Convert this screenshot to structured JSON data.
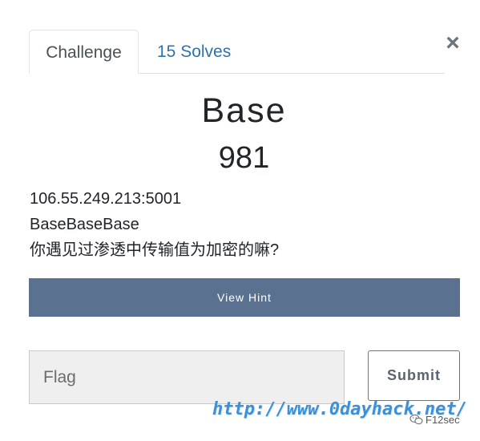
{
  "tabs": {
    "challenge_label": "Challenge",
    "solves_label": "15 Solves"
  },
  "close_icon": "close-icon",
  "challenge": {
    "name": "Base",
    "value": "981",
    "description": [
      "106.55.249.213:5001",
      "BaseBaseBase",
      "你遇见过渗透中传输值为加密的嘛?"
    ]
  },
  "hint": {
    "label": "View Hint"
  },
  "flag": {
    "placeholder": "Flag",
    "value": ""
  },
  "submit": {
    "label": "Submit"
  },
  "watermark": {
    "url": "http://www.0dayhack.net/",
    "brand": "F12sec",
    "icon": "wechat-icon"
  },
  "colors": {
    "hint_button": "#5b7190",
    "link": "#2e72a8",
    "watermark_url": "#3d8fd6"
  }
}
